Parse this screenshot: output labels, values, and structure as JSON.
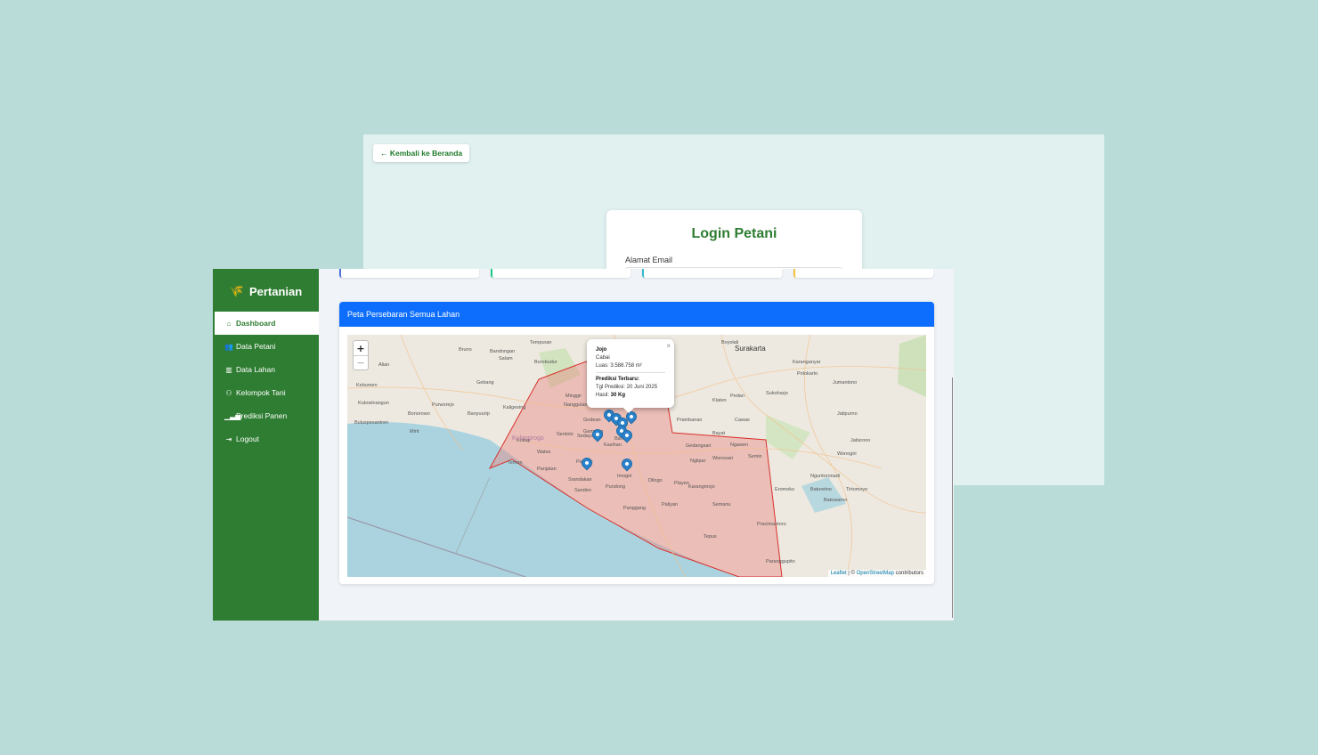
{
  "login_page": {
    "back_button": "← Kembali ke Beranda",
    "title": "Login Petani",
    "email_label": "Alamat Email"
  },
  "dashboard": {
    "brand": "Pertanian",
    "nav": [
      {
        "label": "Dashboard",
        "icon": "home-icon"
      },
      {
        "label": "Data Petani",
        "icon": "users-icon"
      },
      {
        "label": "Data Lahan",
        "icon": "map-icon"
      },
      {
        "label": "Kelompok Tani",
        "icon": "group-icon"
      },
      {
        "label": "Prediksi Panen",
        "icon": "bar-chart-icon"
      },
      {
        "label": "Logout",
        "icon": "logout-icon"
      }
    ],
    "map_card_title": "Peta Persebaran Semua Lahan",
    "map": {
      "zoom_in": "+",
      "zoom_out": "−",
      "attribution_leaflet": "Leaflet",
      "attribution_sep": " | © ",
      "attribution_osm": "OpenStreetMap",
      "attribution_tail": " contributors",
      "place_labels": [
        "Tempuran",
        "Bandongan",
        "Salam",
        "Muntilan",
        "Borobudur",
        "Bruno",
        "Kebumen",
        "Kutowinangun",
        "Alian",
        "Bonorowo",
        "Purworejo",
        "Buluspesantren",
        "Mirit",
        "Gebang",
        "Banyuurip",
        "Kaligesing",
        "Kokap",
        "Wates",
        "Temon",
        "Panjatan",
        "Sentolo",
        "Sedayu",
        "Nanggulan",
        "Godean",
        "Minggir",
        "Mlati",
        "Gamping",
        "Sleman",
        "Kasihan",
        "Bantul",
        "Pandak",
        "Srandakan",
        "Sanden",
        "Pundong",
        "Imogiri",
        "Dlingo",
        "Playen",
        "Wonosari",
        "Semanu",
        "Tepus",
        "Paliyan",
        "Panggang",
        "Karangmojo",
        "Nglipar",
        "Semin",
        "Ngawen",
        "Gedangsari",
        "Prambanan",
        "Klaten",
        "Pedan",
        "Cawas",
        "Bayat",
        "Boyolali",
        "Surakarta",
        "Karanganyar",
        "Sukoharjo",
        "Polokarto",
        "Jumantono",
        "Jatisrono",
        "Baturetno",
        "Wonogiri",
        "Eromoko",
        "Pracimantoro",
        "Paranggupito",
        "Nguntoronadi",
        "Tirtomoyo",
        "Batuwarno",
        "Jatipurno",
        "Kulonprogo"
      ],
      "popup": {
        "close": "×",
        "name": "Jojo",
        "crop": "Cabai",
        "area": "Luas: 3.588.758 m²",
        "pred_title": "Prediksi Terbaru:",
        "pred_date": "Tgl Prediksi: 20 Juni 2025",
        "yield_label": "Hasil: ",
        "yield_value": "30 Kg"
      }
    }
  }
}
